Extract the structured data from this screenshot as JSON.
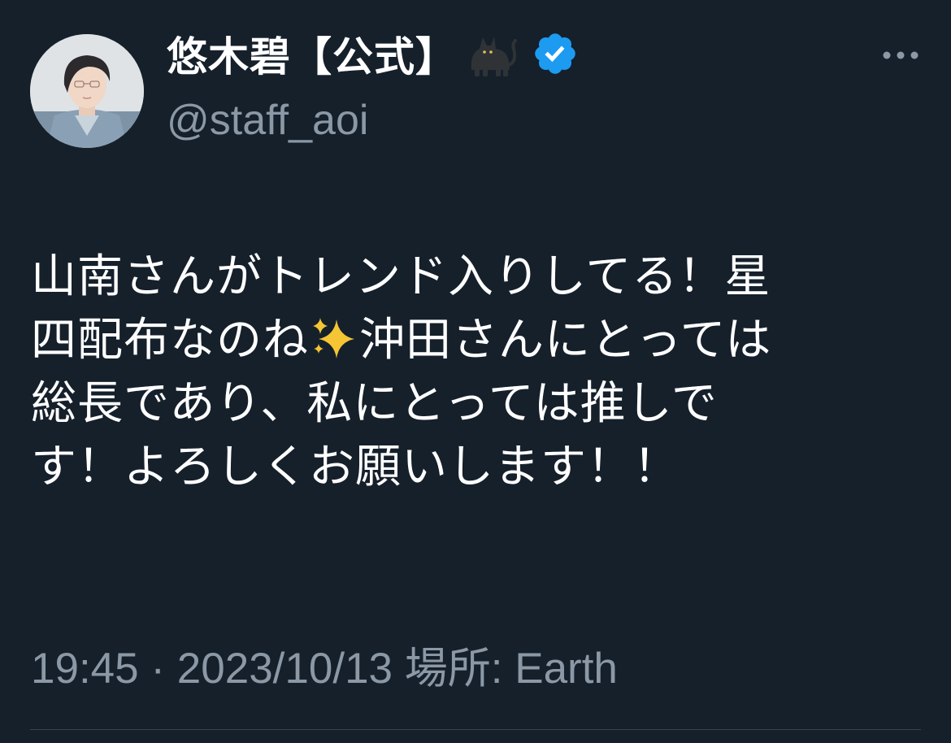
{
  "author": {
    "display_name": "悠木碧【公式】",
    "name_emoji": "black-cat-emoji",
    "verified_icon": "verified-badge-icon",
    "verified_color": "#1d9bf0",
    "handle": "@staff_aoi"
  },
  "more_icon": "more-horizontal-icon",
  "tweet": {
    "lines": [
      "山南さんがトレンド入りしてる！星",
      "四配布なのね",
      "沖田さんにとっては",
      "総長であり、私にとっては推しで",
      "す！よろしくお願いします！！"
    ],
    "inline_emoji": "sparkles-emoji"
  },
  "meta": {
    "time": "19:45",
    "separator": "·",
    "date": "2023/10/13",
    "location_label": "場所:",
    "location": "Earth"
  },
  "colors": {
    "background": "#15202b",
    "text": "#ffffff",
    "secondary_text": "#8b98a5",
    "divider": "#38444d"
  }
}
